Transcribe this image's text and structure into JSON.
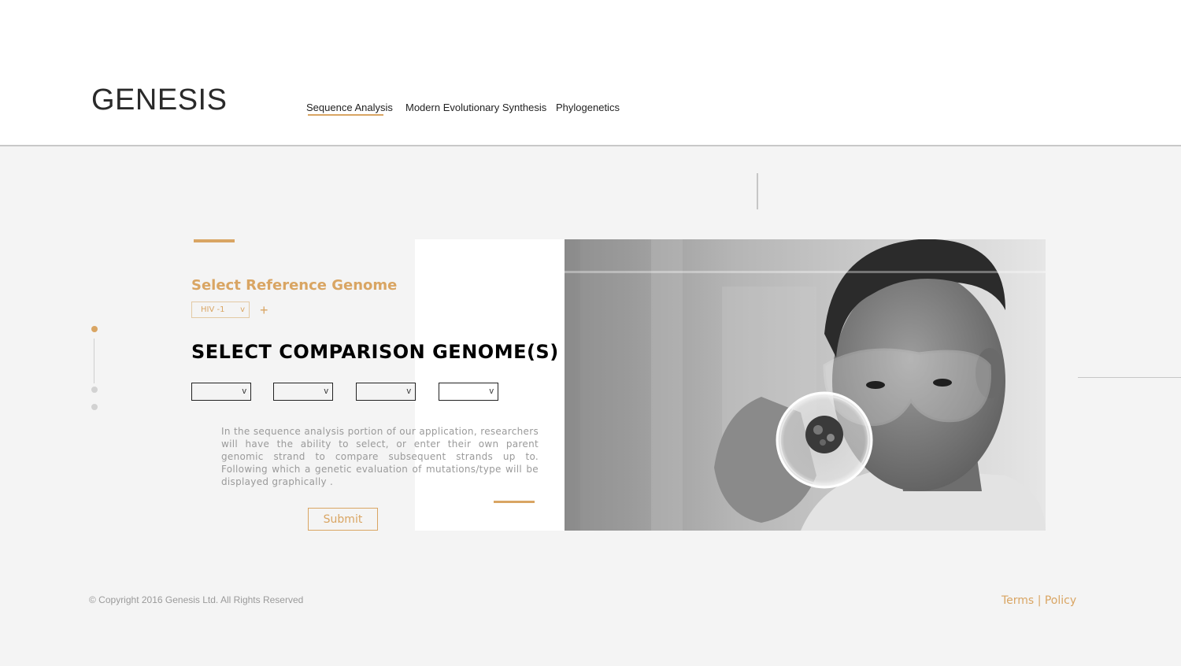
{
  "brand": {
    "logo": "GENESIS"
  },
  "nav": {
    "items": [
      {
        "label": "Sequence Analysis",
        "active": true
      },
      {
        "label": "Modern Evolutionary Synthesis",
        "active": false
      },
      {
        "label": "Phylogenetics",
        "active": false
      }
    ]
  },
  "form": {
    "reference_title": "Select Reference Genome",
    "reference_value": "HIV -1",
    "add_symbol": "+",
    "comparison_title": "SELECT COMPARISON GENOME(S)",
    "comparison_selects": [
      "",
      "",
      "",
      ""
    ],
    "dropdown_symbol": "v",
    "description": "In the sequence analysis portion of our application, researchers will have the ability to select, or enter their own parent genomic strand to compare subsequent strands up to. Following which a genetic evaluation of mutations/type will be displayed graphically .",
    "submit_label": "Submit"
  },
  "pager": {
    "count": 3,
    "active_index": 0
  },
  "footer": {
    "copyright": "© Copyright 2016 Genesis Ltd. All Rights Reserved",
    "terms": "Terms",
    "separator": "|",
    "policy": "Policy"
  },
  "colors": {
    "accent": "#d9a563",
    "background": "#f4f4f4",
    "header": "#ffffff",
    "text_dark": "#222222",
    "text_muted": "#9a9a9a"
  },
  "photo": {
    "subject": "scientist-with-petri-dish"
  }
}
